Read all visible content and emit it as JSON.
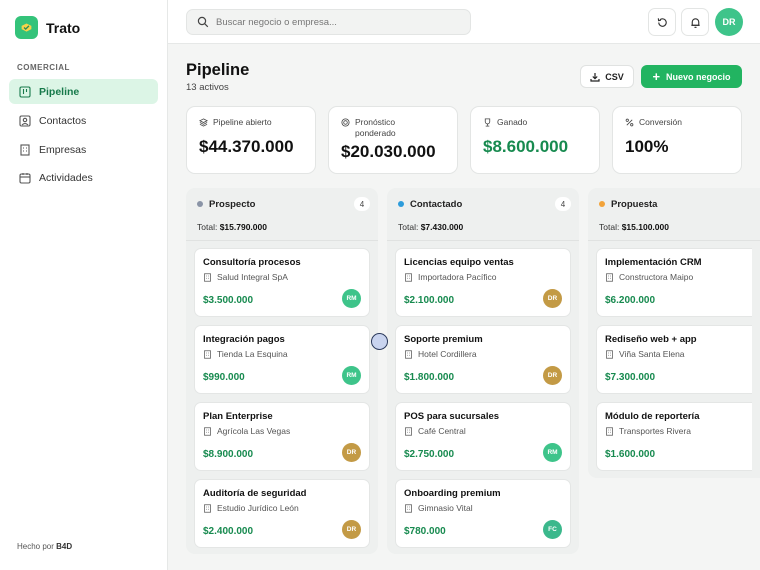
{
  "app": {
    "name": "Trato"
  },
  "sidebar": {
    "section": "COMERCIAL",
    "items": [
      {
        "label": "Pipeline",
        "icon": "kanban-icon",
        "active": true
      },
      {
        "label": "Contactos",
        "icon": "contact-icon",
        "active": false
      },
      {
        "label": "Empresas",
        "icon": "building-icon",
        "active": false
      },
      {
        "label": "Actividades",
        "icon": "calendar-icon",
        "active": false
      }
    ],
    "footer": {
      "prefix": "Hecho por",
      "brand": "B4D"
    }
  },
  "topbar": {
    "search_placeholder": "Buscar negocio o empresa...",
    "user_initials": "DR"
  },
  "page": {
    "title": "Pipeline",
    "subtitle": "13 activos",
    "csv_label": "CSV",
    "new_label": "Nuevo negocio"
  },
  "kpis": [
    {
      "label": "Pipeline abierto",
      "value": "$44.370.000",
      "icon": "layers-icon"
    },
    {
      "label": "Pronóstico ponderado",
      "value": "$20.030.000",
      "icon": "target-icon"
    },
    {
      "label": "Ganado",
      "value": "$8.600.000",
      "icon": "trophy-icon"
    },
    {
      "label": "Conversión",
      "value": "100%",
      "icon": "percent-icon"
    }
  ],
  "columns": [
    {
      "name": "Prospecto",
      "count": "4",
      "total_label": "Total:",
      "total": "$15.790.000",
      "dot_color": "#8a94a6",
      "cards": [
        {
          "title": "Consultoría procesos",
          "company": "Salud Integral SpA",
          "amount": "$3.500.000",
          "owner": "RM"
        },
        {
          "title": "Integración pagos",
          "company": "Tienda La Esquina",
          "amount": "$990.000",
          "owner": "RM"
        },
        {
          "title": "Plan Enterprise",
          "company": "Agrícola Las Vegas",
          "amount": "$8.900.000",
          "owner": "DR"
        },
        {
          "title": "Auditoría de seguridad",
          "company": "Estudio Jurídico León",
          "amount": "$2.400.000",
          "owner": "DR"
        }
      ]
    },
    {
      "name": "Contactado",
      "count": "4",
      "total_label": "Total:",
      "total": "$7.430.000",
      "dot_color": "#2d9cdb",
      "cards": [
        {
          "title": "Licencias equipo ventas",
          "company": "Importadora Pacífico",
          "amount": "$2.100.000",
          "owner": "DR"
        },
        {
          "title": "Soporte premium",
          "company": "Hotel Cordillera",
          "amount": "$1.800.000",
          "owner": "DR"
        },
        {
          "title": "POS para sucursales",
          "company": "Café Central",
          "amount": "$2.750.000",
          "owner": "RM"
        },
        {
          "title": "Onboarding premium",
          "company": "Gimnasio Vital",
          "amount": "$780.000",
          "owner": "FC"
        }
      ]
    },
    {
      "name": "Propuesta",
      "count": "",
      "total_label": "Total:",
      "total": "$15.100.000",
      "dot_color": "#f2a33a",
      "cards": [
        {
          "title": "Implementación CRM",
          "company": "Constructora Maipo",
          "amount": "$6.200.000",
          "owner": ""
        },
        {
          "title": "Rediseño web + app",
          "company": "Viña Santa Elena",
          "amount": "$7.300.000",
          "owner": ""
        },
        {
          "title": "Módulo de reportería",
          "company": "Transportes Rivera",
          "amount": "$1.600.000",
          "owner": ""
        }
      ]
    }
  ],
  "colors": {
    "accent": "#22b461",
    "money": "#178a4f",
    "avatar_RM": "#3ec48a",
    "avatar_DR": "#c39a45",
    "avatar_FC": "#3bb88c"
  }
}
